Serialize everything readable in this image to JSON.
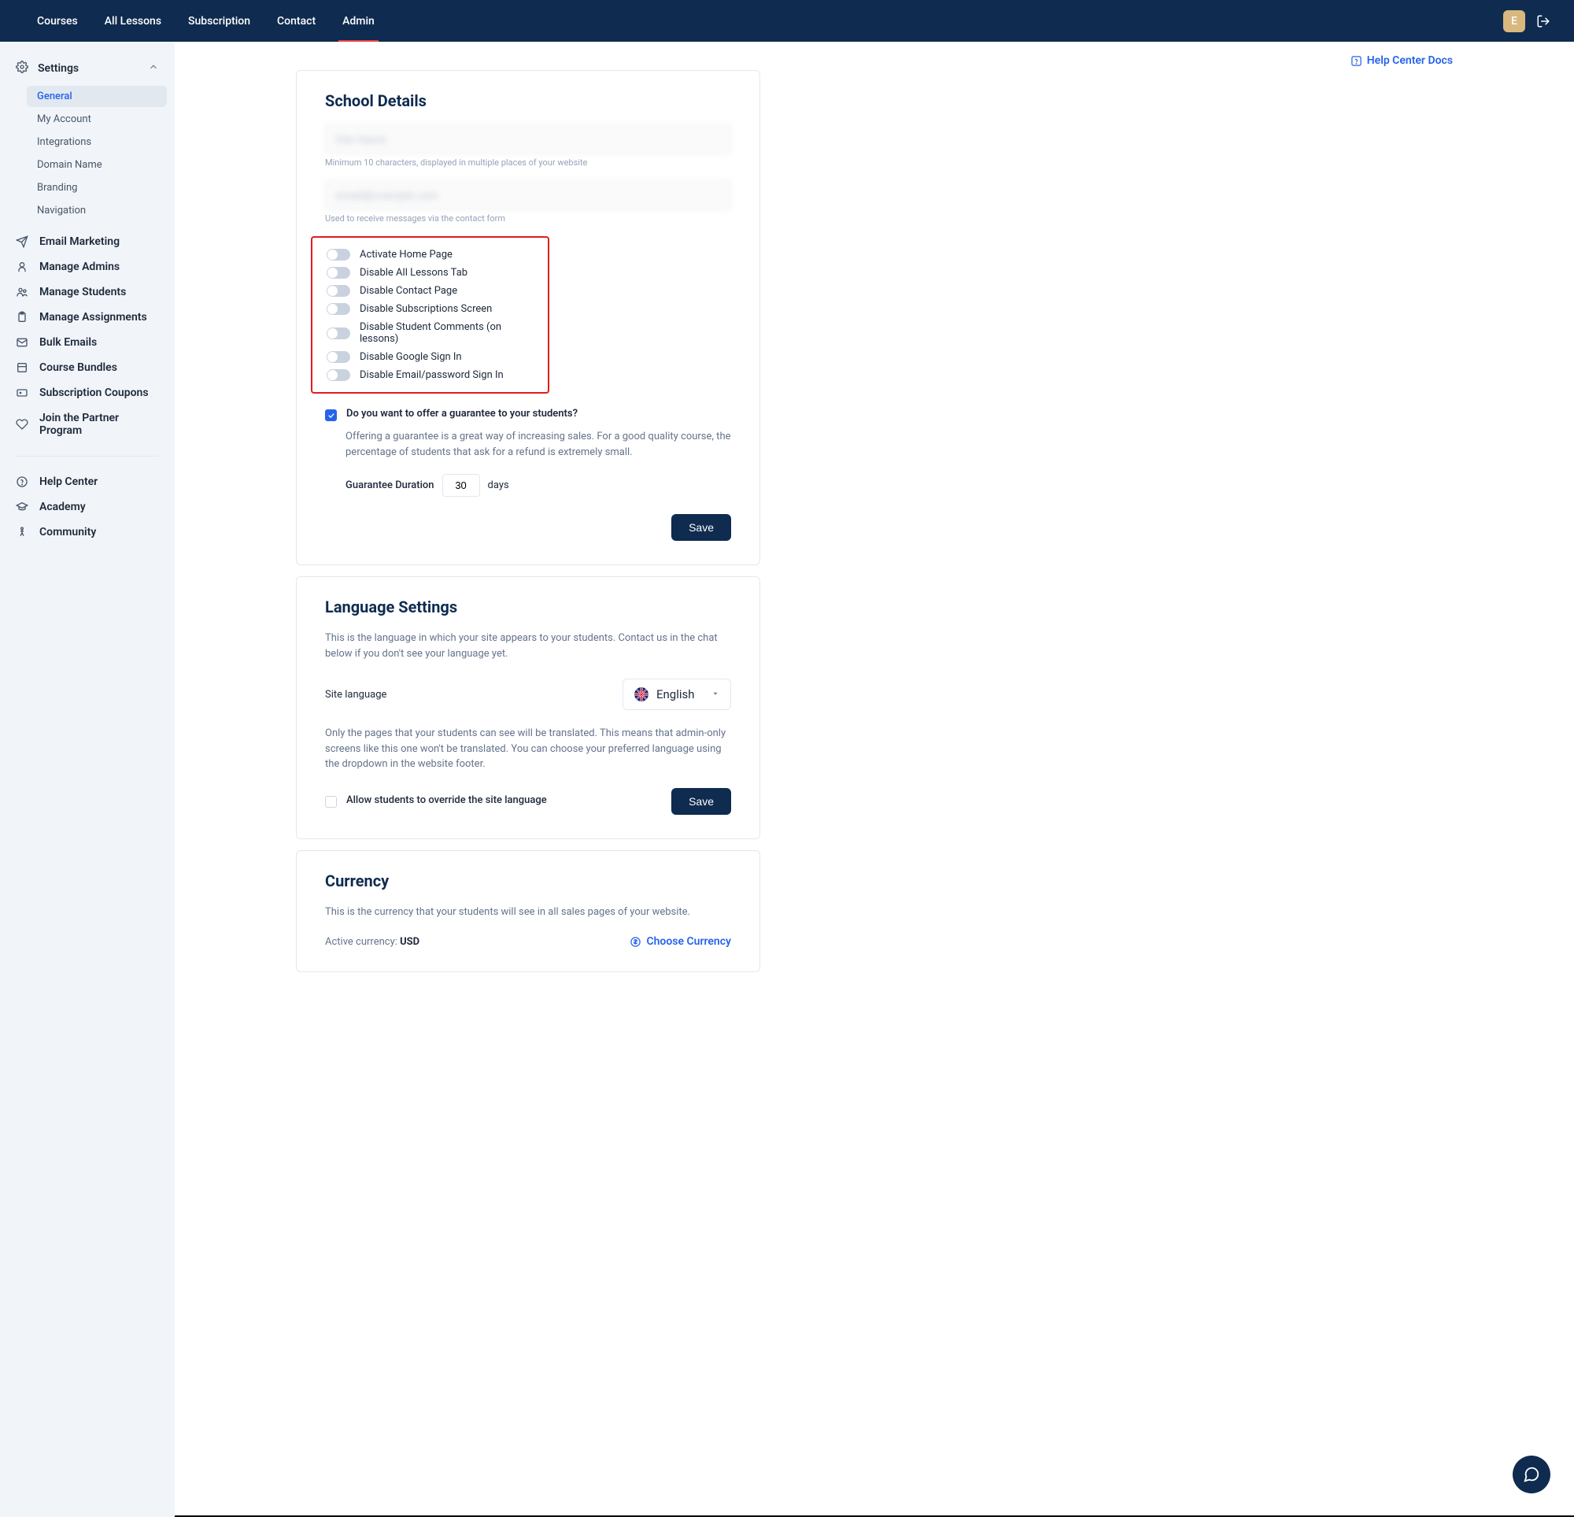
{
  "topnav": {
    "items": [
      {
        "label": "Courses"
      },
      {
        "label": "All Lessons"
      },
      {
        "label": "Subscription"
      },
      {
        "label": "Contact"
      },
      {
        "label": "Admin"
      }
    ],
    "avatar_letter": "E"
  },
  "sidebar": {
    "settings_label": "Settings",
    "subitems": [
      {
        "label": "General"
      },
      {
        "label": "My Account"
      },
      {
        "label": "Integrations"
      },
      {
        "label": "Domain Name"
      },
      {
        "label": "Branding"
      },
      {
        "label": "Navigation"
      }
    ],
    "items": [
      {
        "label": "Email Marketing"
      },
      {
        "label": "Manage Admins"
      },
      {
        "label": "Manage Students"
      },
      {
        "label": "Manage Assignments"
      },
      {
        "label": "Bulk Emails"
      },
      {
        "label": "Course Bundles"
      },
      {
        "label": "Subscription Coupons"
      },
      {
        "label": "Join the Partner Program"
      }
    ],
    "footer_items": [
      {
        "label": "Help Center"
      },
      {
        "label": "Academy"
      },
      {
        "label": "Community"
      }
    ]
  },
  "help_docs_label": "Help Center Docs",
  "school_details": {
    "title": "School Details",
    "name_value": "Site Name",
    "name_help": "Minimum 10 characters, displayed in multiple places of your website",
    "email_value": "email@example.com",
    "email_help": "Used to receive messages via the contact form",
    "toggles": [
      {
        "label": "Activate Home Page"
      },
      {
        "label": "Disable All Lessons Tab"
      },
      {
        "label": "Disable Contact Page"
      },
      {
        "label": "Disable Subscriptions Screen"
      },
      {
        "label": "Disable Student Comments (on lessons)"
      },
      {
        "label": "Disable Google Sign In"
      },
      {
        "label": "Disable Email/password Sign In"
      }
    ],
    "guarantee_checkbox_label": "Do you want to offer a guarantee to your students?",
    "guarantee_desc": "Offering a guarantee is a great way of increasing sales. For a good quality course, the percentage of students that ask for a refund is extremely small.",
    "duration_label": "Guarantee Duration",
    "duration_value": "30",
    "days_label": "days",
    "save_label": "Save"
  },
  "language": {
    "title": "Language Settings",
    "desc": "This is the language in which your site appears to your students. Contact us in the chat below if you don't see your language yet.",
    "site_lang_label": "Site language",
    "selected": "English",
    "note": "Only the pages that your students can see will be translated. This means that admin-only screens like this one won't be translated. You can choose your preferred language using the dropdown in the website footer.",
    "allow_override_label": "Allow students to override the site language",
    "save_label": "Save"
  },
  "currency": {
    "title": "Currency",
    "desc": "This is the currency that your students will see in all sales pages of your website.",
    "active_label": "Active currency: ",
    "active_value": "USD",
    "choose_label": "Choose Currency"
  }
}
